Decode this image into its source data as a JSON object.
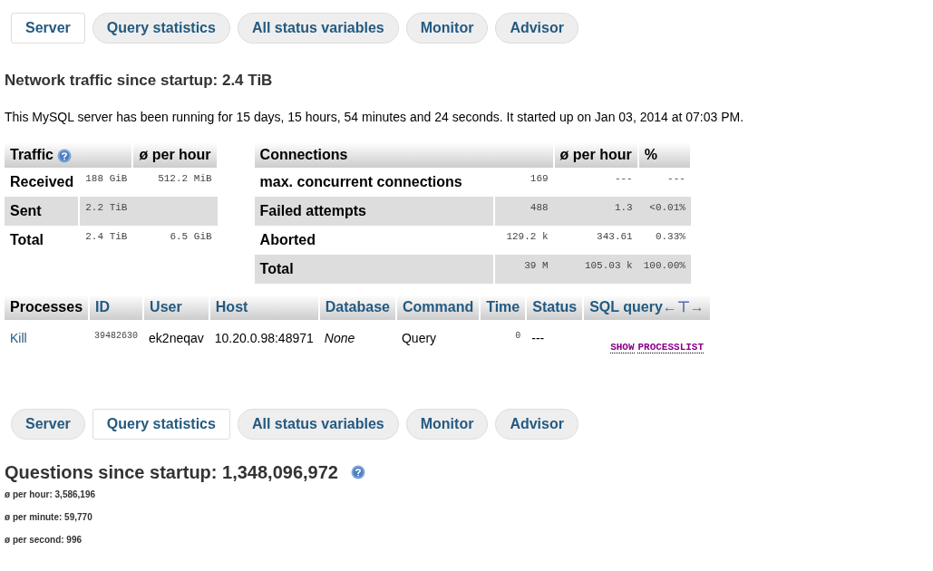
{
  "tabs_top": [
    {
      "label": "Server",
      "selected": true
    },
    {
      "label": "Query statistics",
      "selected": false
    },
    {
      "label": "All status variables",
      "selected": false
    },
    {
      "label": "Monitor",
      "selected": false
    },
    {
      "label": "Advisor",
      "selected": false
    }
  ],
  "traffic_heading": "Network traffic since startup: 2.4 TiB",
  "uptime_text": "This MySQL server has been running for 15 days, 15 hours, 54 minutes and 24 seconds. It started up on Jan 03, 2014 at 07:03 PM.",
  "traffic_table": {
    "columns": [
      "Traffic",
      "ø per hour"
    ],
    "rows": [
      {
        "label": "Received",
        "value": "188 GiB",
        "per_hour": "512.2 MiB"
      },
      {
        "label": "Sent",
        "value": "2.2 TiB"
      },
      {
        "label": "Total",
        "value": "2.4 TiB",
        "per_hour": "6.5 GiB"
      }
    ]
  },
  "connections_table": {
    "columns": [
      "Connections",
      "ø per hour",
      "%"
    ],
    "rows": [
      {
        "label": "max. concurrent connections",
        "value": "169",
        "per_hour": "---",
        "percent": "---"
      },
      {
        "label": "Failed attempts",
        "value": "488",
        "per_hour": "1.3",
        "percent": "<0.01%"
      },
      {
        "label": "Aborted",
        "value": "129.2 k",
        "per_hour": "343.61",
        "percent": "0.33%"
      },
      {
        "label": "Total",
        "value": "39 M",
        "per_hour": "105.03 k",
        "percent": "100.00%"
      }
    ]
  },
  "processes_table": {
    "columns": [
      {
        "label": "Processes",
        "kind": "plain"
      },
      {
        "label": "ID",
        "kind": "link"
      },
      {
        "label": "User",
        "kind": "link"
      },
      {
        "label": "Host",
        "kind": "link"
      },
      {
        "label": "Database",
        "kind": "link"
      },
      {
        "label": "Command",
        "kind": "link"
      },
      {
        "label": "Time",
        "kind": "link"
      },
      {
        "label": "Status",
        "kind": "link"
      },
      {
        "label": "SQL query",
        "kind": "link"
      }
    ],
    "toggle": "←⊤→",
    "rows": [
      {
        "action": "Kill",
        "id": "39482630",
        "user": "ek2neqav",
        "host": "10.20.0.98:48971",
        "database": "None",
        "command": "Query",
        "time": "0",
        "status": "---",
        "query": [
          "SHOW",
          "PROCESSLIST"
        ]
      }
    ]
  },
  "tabs_bottom": [
    {
      "label": "Server",
      "selected": false
    },
    {
      "label": "Query statistics",
      "selected": true
    },
    {
      "label": "All status variables",
      "selected": false
    },
    {
      "label": "Monitor",
      "selected": false
    },
    {
      "label": "Advisor",
      "selected": false
    }
  ],
  "questions_heading": "Questions since startup: 1,348,096,972",
  "rates": [
    "ø per hour: 3,586,196",
    "ø per minute: 59,770",
    "ø per second: 996"
  ]
}
